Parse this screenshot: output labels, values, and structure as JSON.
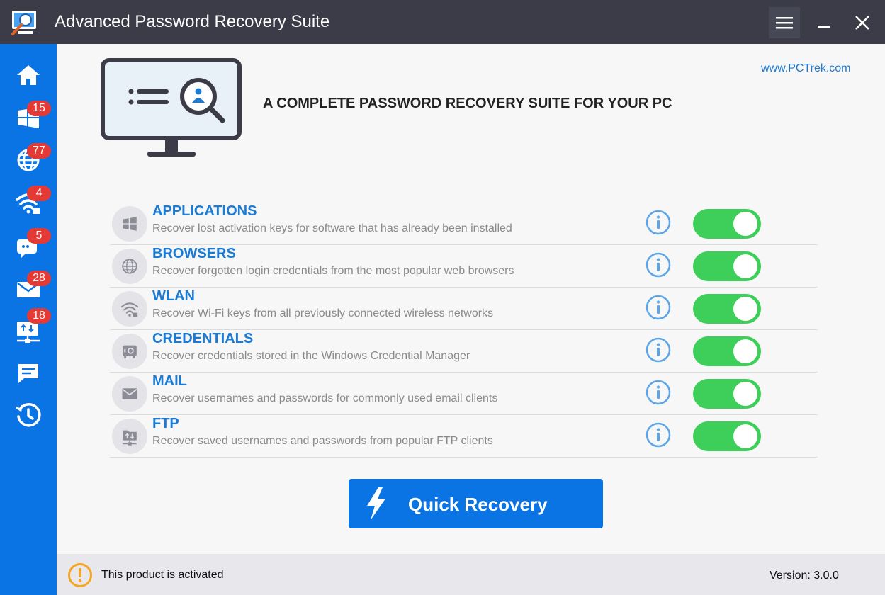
{
  "window": {
    "title": "Advanced Password Recovery Suite"
  },
  "sidebar": {
    "items": [
      {
        "name": "home",
        "icon": "home-icon"
      },
      {
        "name": "applications",
        "icon": "windows-icon",
        "badge": "15"
      },
      {
        "name": "browsers",
        "icon": "globe-icon",
        "badge": "77"
      },
      {
        "name": "wlan",
        "icon": "wifi-lock-icon",
        "badge": "4"
      },
      {
        "name": "credentials",
        "icon": "chat-key-icon",
        "badge": "5"
      },
      {
        "name": "mail",
        "icon": "mail-icon",
        "badge": "28"
      },
      {
        "name": "ftp",
        "icon": "ftp-network-icon",
        "badge": "18"
      },
      {
        "name": "messages",
        "icon": "message-icon"
      },
      {
        "name": "history",
        "icon": "history-clock-icon"
      }
    ]
  },
  "header": {
    "headline": "A COMPLETE PASSWORD RECOVERY SUITE FOR YOUR PC",
    "link": "www.PCTrek.com"
  },
  "modules": [
    {
      "title": "APPLICATIONS",
      "desc": "Recover lost activation keys for software that has already been installed",
      "icon": "windows-icon",
      "enabled": true
    },
    {
      "title": "BROWSERS",
      "desc": "Recover forgotten login credentials from the most popular web browsers",
      "icon": "globe-icon",
      "enabled": true
    },
    {
      "title": "WLAN",
      "desc": "Recover Wi-Fi keys from all previously connected wireless networks",
      "icon": "wifi-lock-icon",
      "enabled": true
    },
    {
      "title": "CREDENTIALS",
      "desc": "Recover credentials stored in the Windows Credential Manager",
      "icon": "safe-icon",
      "enabled": true
    },
    {
      "title": "MAIL",
      "desc": "Recover usernames and passwords for commonly used email clients",
      "icon": "mail-icon",
      "enabled": true
    },
    {
      "title": "FTP",
      "desc": "Recover saved usernames and passwords from popular FTP clients",
      "icon": "ftp-folder-icon",
      "enabled": true
    }
  ],
  "actions": {
    "quick_recovery": "Quick Recovery"
  },
  "status": {
    "activation": "This product is activated",
    "version": "Version: 3.0.0"
  },
  "colors": {
    "accent": "#0b74e5",
    "titlebar": "#3b3c48",
    "toggle_on": "#3ecf5a",
    "badge": "#e53935",
    "link": "#1a7ad4"
  }
}
